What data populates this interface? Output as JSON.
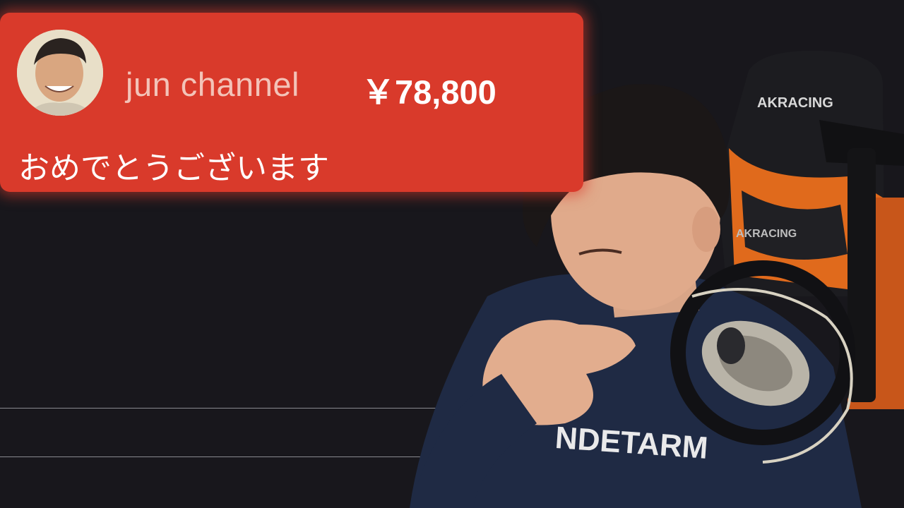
{
  "superchat": {
    "author": "jun channel",
    "amount": "￥78,800",
    "message": "おめでとうございます",
    "card_color": "#d93a2b",
    "avatar_icon": "person-avatar-icon"
  },
  "scene": {
    "chair_brand_top": "AKRACING",
    "chair_brand_bottom": "AKRACING",
    "shirt_text": "NDETARM",
    "chair_accent_color": "#e06a1c"
  }
}
